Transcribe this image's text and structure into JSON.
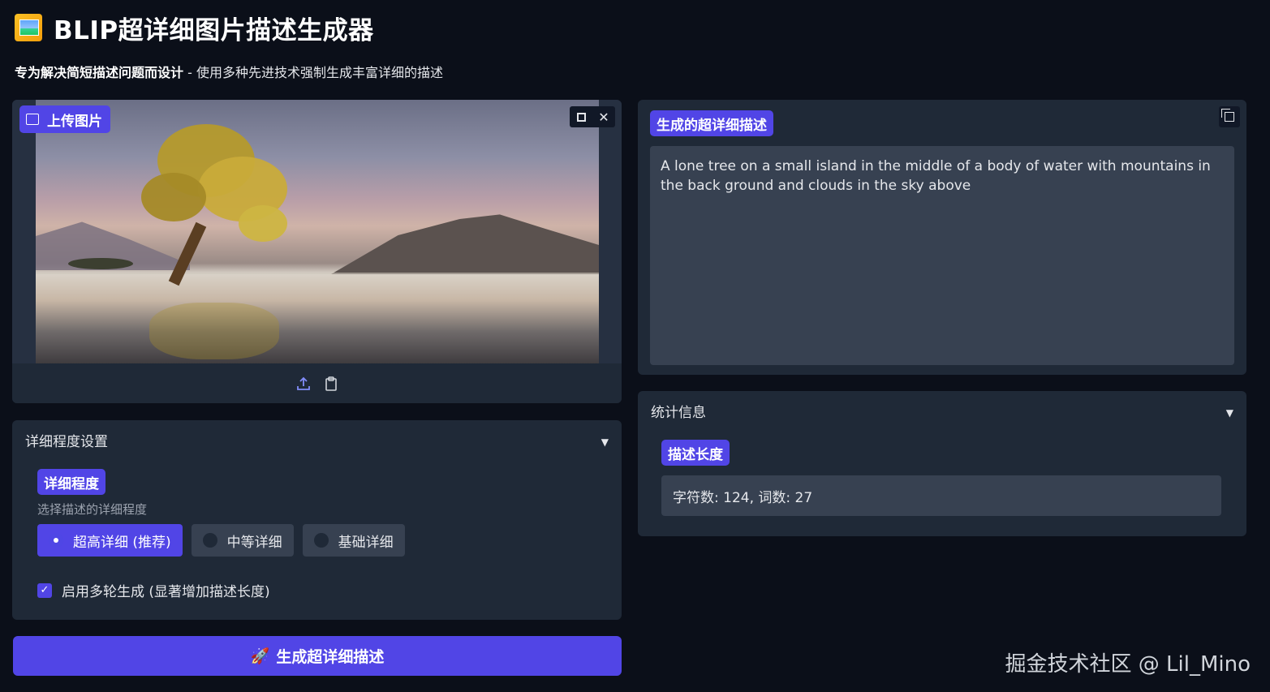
{
  "header": {
    "title": "BLIP超详细图片描述生成器",
    "subtitle_bold": "专为解决简短描述问题而设计",
    "subtitle_rest": " - 使用多种先进技术强制生成丰富详细的描述"
  },
  "upload": {
    "label": "上传图片",
    "icons": [
      "image-icon",
      "fullscreen-icon",
      "close-icon",
      "upload-icon",
      "clipboard-icon"
    ]
  },
  "detail_settings": {
    "accordion_title": "详细程度设置",
    "badge": "详细程度",
    "info": "选择描述的详细程度",
    "options": [
      "超高详细 (推荐)",
      "中等详细",
      "基础详细"
    ],
    "selected": "超高详细 (推荐)",
    "multi_round_label": "启用多轮生成 (显著增加描述长度)",
    "multi_round_checked": true
  },
  "generate_button": {
    "label": "生成超详细描述"
  },
  "output": {
    "badge": "生成的超详细描述",
    "text": "A lone tree on a small island in the middle of a body of water with mountains in the back ground and clouds in the sky above"
  },
  "stats": {
    "accordion_title": "统计信息",
    "badge": "描述长度",
    "value": "字符数: 124, 词数: 27"
  },
  "watermark": "掘金技术社区 @ Lil_Mino",
  "colors": {
    "accent": "#5145e6",
    "background": "#0b0f19",
    "panel": "#1f2937",
    "input": "#374151"
  }
}
